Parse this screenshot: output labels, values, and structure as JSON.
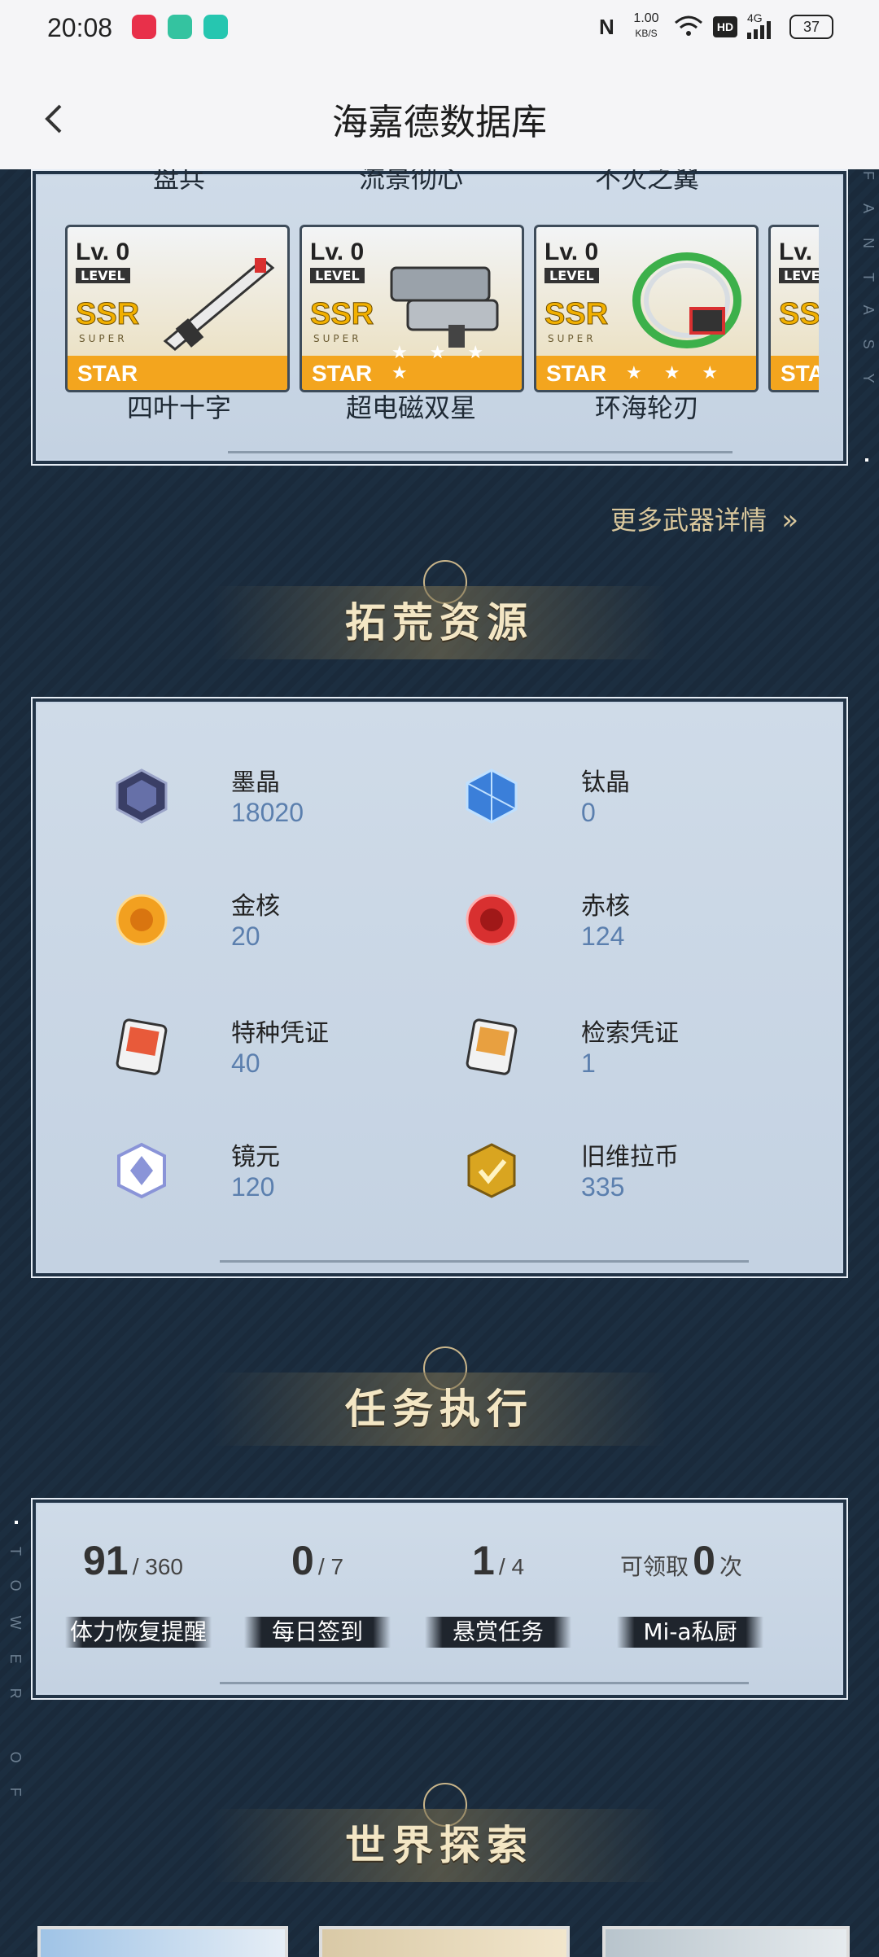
{
  "status_bar": {
    "time": "20:08",
    "net_speed": "1.00",
    "net_unit": "KB/S",
    "hd": "HD",
    "signal": "4G",
    "battery": "37"
  },
  "header": {
    "title": "海嘉德数据库"
  },
  "weapons_top_row_cut": [
    "盘兵",
    "流景彻心",
    "不灭之翼"
  ],
  "weapons": [
    {
      "lv": "Lv. 0",
      "level": "LEVEL",
      "ssr": "SSR",
      "super": "SUPER",
      "star": "STAR",
      "stars": "",
      "name": "四叶十字"
    },
    {
      "lv": "Lv. 0",
      "level": "LEVEL",
      "ssr": "SSR",
      "super": "SUPER",
      "star": "STAR",
      "stars": "★ ★ ★ ★",
      "name": "超电磁双星"
    },
    {
      "lv": "Lv. 0",
      "level": "LEVEL",
      "ssr": "SSR",
      "super": "SUPER",
      "star": "STAR",
      "stars": "★ ★ ★",
      "name": "环海轮刃"
    },
    {
      "lv": "Lv. 0",
      "level": "LEVEL",
      "ssr": "SSR",
      "super": "",
      "star": "STAR",
      "stars": "",
      "name": ""
    }
  ],
  "more_weapons_link": "更多武器详情",
  "sections": {
    "resources": "拓荒资源",
    "tasks": "任务执行",
    "explore": "世界探索"
  },
  "resources": [
    {
      "name": "墨晶",
      "value": "18020",
      "icon": "dark-crystal-icon",
      "color": "#3a3f66"
    },
    {
      "name": "钛晶",
      "value": "0",
      "icon": "blue-crystal-icon",
      "color": "#3b7fd9"
    },
    {
      "name": "金核",
      "value": "20",
      "icon": "gold-core-icon",
      "color": "#f2a020"
    },
    {
      "name": "赤核",
      "value": "124",
      "icon": "red-core-icon",
      "color": "#d83030"
    },
    {
      "name": "特种凭证",
      "value": "40",
      "icon": "special-voucher-icon",
      "color": "#e85a3a"
    },
    {
      "name": "检索凭证",
      "value": "1",
      "icon": "search-voucher-icon",
      "color": "#e8a040"
    },
    {
      "name": "镜元",
      "value": "120",
      "icon": "mirror-gem-icon",
      "color": "#8a94d8"
    },
    {
      "name": "旧维拉币",
      "value": "335",
      "icon": "vera-coin-icon",
      "color": "#d9a520"
    }
  ],
  "tasks": [
    {
      "num": "91",
      "den": "/ 360",
      "label": "体力恢复提醒"
    },
    {
      "num": "0",
      "den": "/ 7",
      "label": "每日签到"
    },
    {
      "num": "1",
      "den": "/ 4",
      "label": "悬赏任务"
    },
    {
      "prefix": "可领取",
      "num": "0",
      "suffix": "次",
      "label": "Mi-a私厨"
    }
  ],
  "side_deco": {
    "right": "FANTASY",
    "left": "TOWER OF"
  }
}
